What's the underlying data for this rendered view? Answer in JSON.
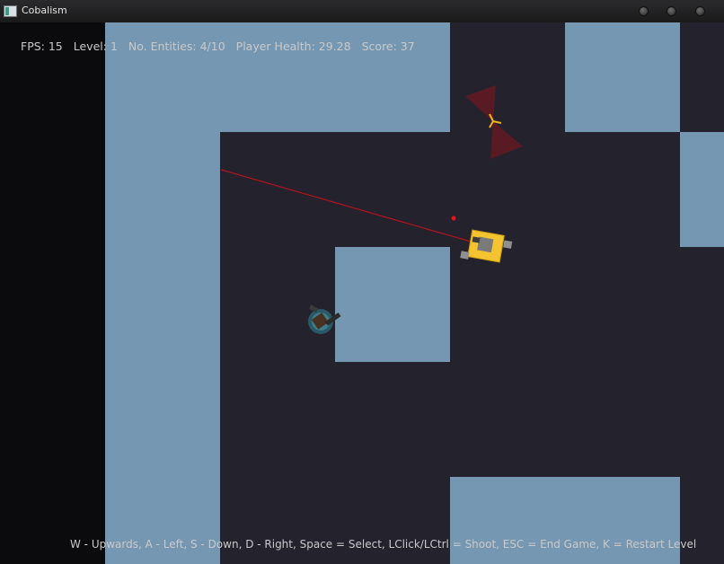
{
  "window": {
    "title": "Cobalism"
  },
  "hud": {
    "fps": "FPS: 15",
    "level": "Level: 1",
    "entities": "No. Entities: 4/10",
    "health": "Player Health: 29.28",
    "score": "Score: 37"
  },
  "controls_text": "W - Upwards, A - Left, S - Down, D - Right, Space = Select, LClick/LCtrl = Shoot, ESC = End Game, K = Restart Level",
  "colors": {
    "wall": "#7597b2",
    "floor": "#24222d",
    "void": "#0b0b0d",
    "player": "#f4c430",
    "laser": "#b3131b",
    "sensor_cone": "#5a1a24"
  }
}
